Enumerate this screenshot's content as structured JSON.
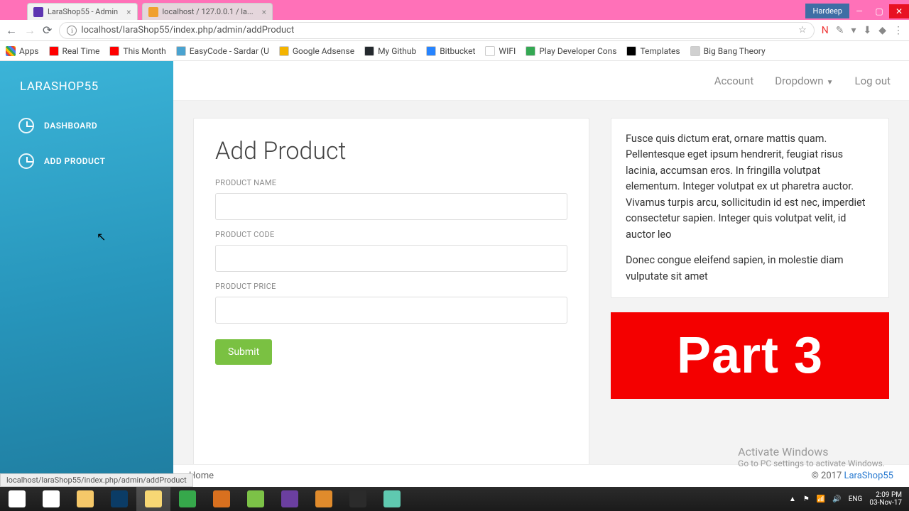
{
  "titlebar": {
    "tabs": [
      {
        "title": "LaraShop55 - Admin",
        "fav_bg": "#5e35b1"
      },
      {
        "title": "localhost / 127.0.0.1 / la...",
        "fav_bg": "#f0a030"
      }
    ],
    "user_badge": "Hardeep"
  },
  "toolbar": {
    "url": "localhost/laraShop55/index.php/admin/addProduct"
  },
  "bookmarks": {
    "apps": "Apps",
    "items": [
      {
        "label": "Real Time",
        "bg": "#ff0000"
      },
      {
        "label": "This Month",
        "bg": "#ff0000"
      },
      {
        "label": "EasyCode - Sardar (U",
        "bg": "#4aa3d0"
      },
      {
        "label": "Google Adsense",
        "bg": "#f4b400"
      },
      {
        "label": "My Github",
        "bg": "#24292e"
      },
      {
        "label": "Bitbucket",
        "bg": "#2684ff"
      },
      {
        "label": "WIFI",
        "bg": "#ffffff"
      },
      {
        "label": "Play Developer Cons",
        "bg": "#34a853"
      },
      {
        "label": "Templates",
        "bg": "#000"
      },
      {
        "label": "Big Bang Theory",
        "bg": "#d0d0d0"
      }
    ]
  },
  "sidebar": {
    "brand": "LARASHOP55",
    "items": [
      {
        "label": "DASHBOARD"
      },
      {
        "label": "ADD PRODUCT"
      }
    ]
  },
  "header": {
    "account": "Account",
    "dropdown": "Dropdown",
    "logout": "Log out"
  },
  "form": {
    "title": "Add Product",
    "labels": {
      "name": "PRODUCT NAME",
      "code": "PRODUCT CODE",
      "price": "PRODUCT PRICE"
    },
    "submit": "Submit"
  },
  "info_card": {
    "p1": "Fusce quis dictum erat, ornare mattis quam. Pellentesque eget ipsum hendrerit, feugiat risus lacinia, accumsan eros. In fringilla volutpat elementum. Integer volutpat ex ut pharetra auctor. Vivamus turpis arcu, sollicitudin id est nec, imperdiet consectetur sapien. Integer quis volutpat velit, id auctor leo",
    "p2": "Donec congue eleifend sapien, in molestie diam vulputate sit amet"
  },
  "banner": "Part 3",
  "watermark": {
    "line1": "Activate Windows",
    "line2": "Go to PC settings to activate Windows."
  },
  "footer": {
    "home": "Home",
    "copyright": "© 2017 ",
    "brand_link": "LaraShop55"
  },
  "status_link": "localhost/laraShop55/index.php/admin/addProduct",
  "taskbar": {
    "icons": [
      "#ffffff",
      "#f5c869",
      "#0b3c66",
      "#f7d774",
      "#36a84b",
      "#d8701f",
      "#7cc247",
      "#6b3fa0",
      "#e08b2c",
      "#2b2b2b",
      "#5fc9b0"
    ],
    "tray": {
      "lang": "ENG",
      "time": "2:09 PM",
      "date": "03-Nov-17"
    }
  }
}
